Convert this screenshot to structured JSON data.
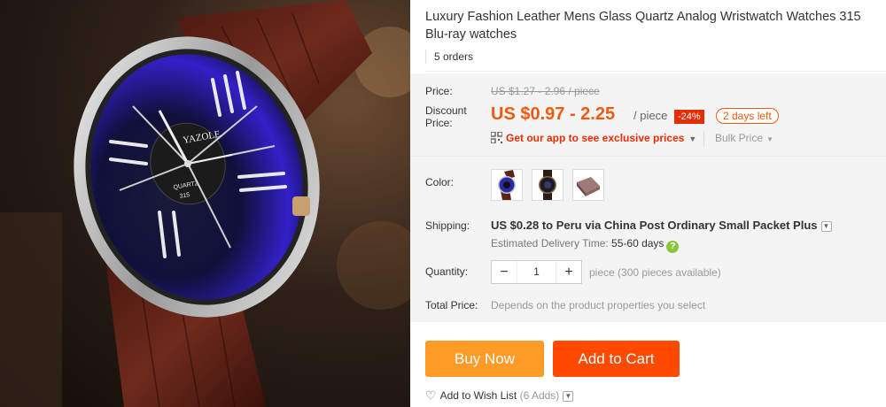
{
  "product": {
    "title": "Luxury Fashion Leather Mens Glass Quartz Analog Wristwatch Watches 315 Blu-ray watches",
    "orders": "5 orders",
    "watch_brand": "YAZOLE",
    "watch_model": "QUARTZ",
    "watch_number": "315"
  },
  "price": {
    "label": "Price:",
    "original": "US $1.27 - 2.96 / piece",
    "discount_label": "Discount Price:",
    "discount_price": "US $0.97 - 2.25",
    "unit": "/ piece",
    "discount_pct": "-24%",
    "time_left": "2 days left",
    "app_link": "Get our app to see exclusive prices",
    "bulk": "Bulk Price"
  },
  "color": {
    "label": "Color:",
    "options": [
      "watch-black-blue",
      "watch-dark-gold",
      "gift-box"
    ]
  },
  "shipping": {
    "label": "Shipping:",
    "cost": "US $0.28",
    "to_text": "to Peru via China Post Ordinary Small Packet Plus",
    "delivery_label": "Estimated Delivery Time:",
    "delivery_days": "55-60 days"
  },
  "quantity": {
    "label": "Quantity:",
    "value": "1",
    "available": "piece (300 pieces available)"
  },
  "total": {
    "label": "Total Price:",
    "value": "Depends on the product properties you select"
  },
  "actions": {
    "buy_now": "Buy Now",
    "add_to_cart": "Add to Cart",
    "wishlist": "Add to Wish List",
    "wishlist_count": "(6 Adds)"
  },
  "colors": {
    "accent_orange": "#f0590e",
    "buy_now": "#ff9b26",
    "add_to_cart": "#ff4a00",
    "discount_badge": "#e62e04"
  }
}
